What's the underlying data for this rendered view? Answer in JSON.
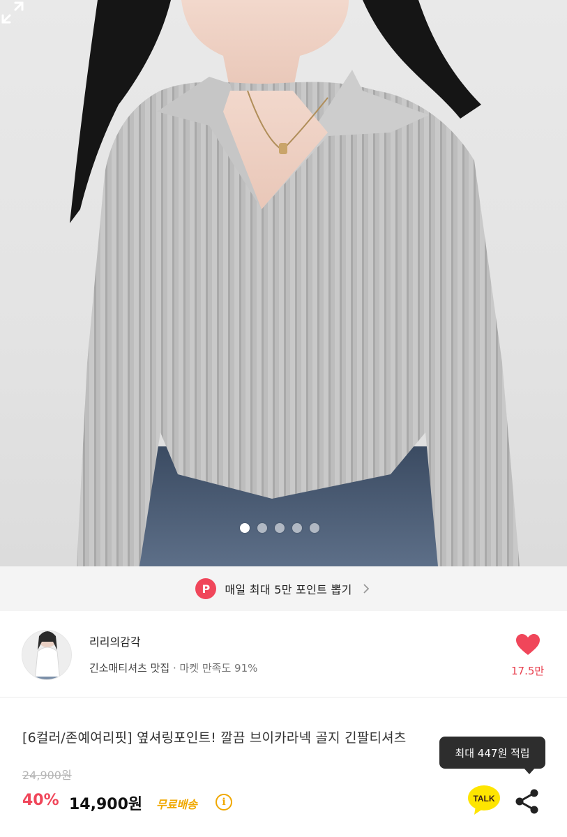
{
  "gallery": {
    "slide_count": 5,
    "active_index": 0,
    "expand_icon": "expand-icon"
  },
  "point_banner": {
    "badge": "P",
    "text": "매일 최대 5만 포인트 뽑기",
    "icon": "chevron-right-icon"
  },
  "seller": {
    "name": "리리의감각",
    "tagline": "긴소매티셔츠 맛집",
    "satisfaction": "· 마켓 만족도 91%",
    "likes": "17.5만",
    "colors": {
      "heart": "#f0465a"
    }
  },
  "product": {
    "title": "[6컬러/존예여리핏] 옆셔링포인트! 깔끔 브이카라넥 골지 긴팔티셔츠",
    "original_price": "24,900원",
    "discount": "40%",
    "price": "14,900원",
    "shipping": "무료배송",
    "info_icon_glyph": "i"
  },
  "tooltip": {
    "text": "최대 447원 적립"
  },
  "actions": {
    "talk_label": "TALK",
    "share_icon": "share-icon"
  },
  "colors": {
    "accent": "#f0465a",
    "shipping": "#f0a800",
    "tooltip_bg": "#2d2d2d",
    "talk_bg": "#fee500"
  }
}
